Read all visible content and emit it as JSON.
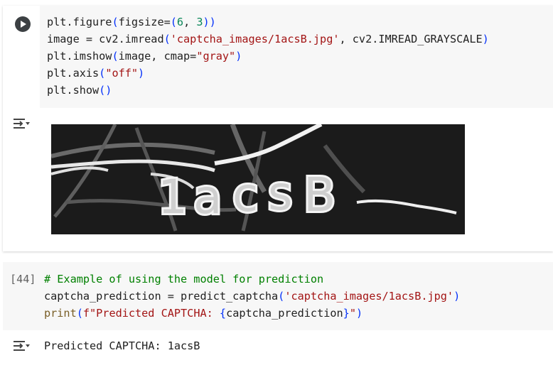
{
  "cell1": {
    "lines": [
      {
        "p1": "plt.figure",
        "p2": "(",
        "p3": "figsize=",
        "p4": "(",
        "p5": "6",
        "p6": ", ",
        "p7": "3",
        "p8": "))"
      },
      {
        "p1": "image = cv2.imread",
        "p2": "(",
        "p3": "'captcha_images/1acsB.jpg'",
        "p4": ", cv2.IMREAD_GRAYSCALE",
        "p5": ")"
      },
      {
        "p1": "plt.imshow",
        "p2": "(",
        "p3": "image, cmap=",
        "p4": "\"gray\"",
        "p5": ")"
      },
      {
        "p1": "plt.axis",
        "p2": "(",
        "p3": "\"off\"",
        "p4": ")"
      },
      {
        "p1": "plt.show",
        "p2": "()"
      }
    ],
    "output_image_text": "1acsB"
  },
  "cell2": {
    "execution_count": "[44]",
    "comment": "# Example of using the model for prediction",
    "line2": {
      "p1": "captcha_prediction = predict_captcha",
      "p2": "(",
      "p3": "'captcha_images/1acsB.jpg'",
      "p4": ")"
    },
    "line3": {
      "p1": "print",
      "p2": "(",
      "p3": "f\"Predicted CAPTCHA: ",
      "p4": "{",
      "p5": "captcha_prediction",
      "p6": "}",
      "p7": "\"",
      "p8": ")"
    },
    "output": "Predicted CAPTCHA: 1acsB"
  },
  "icons": {
    "run": "play-icon",
    "output_toggle": "output-toggle-icon"
  }
}
